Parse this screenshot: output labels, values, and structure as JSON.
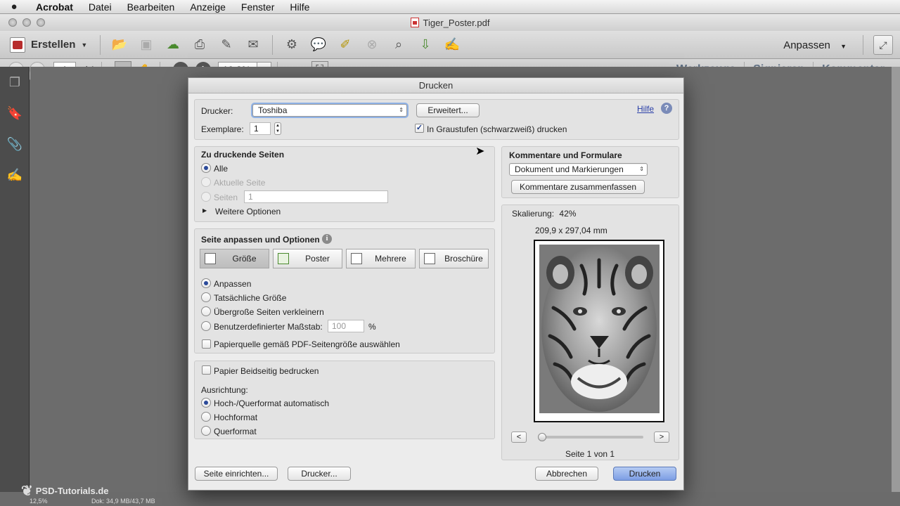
{
  "menubar": {
    "apple": "",
    "app": "Acrobat",
    "items": [
      "Datei",
      "Bearbeiten",
      "Anzeige",
      "Fenster",
      "Hilfe"
    ]
  },
  "window": {
    "title": "Tiger_Poster.pdf"
  },
  "toolbar": {
    "create_label": "Erstellen",
    "customize_label": "Anpassen",
    "page_current": "1",
    "page_total": "/ 1",
    "zoom": "19,3%",
    "tabs": [
      "Werkzeuge",
      "Signieren",
      "Kommentar"
    ]
  },
  "dialog": {
    "title": "Drucken",
    "printer_label": "Drucker:",
    "printer_value": "Toshiba",
    "advanced_button": "Erweitert...",
    "help_link": "Hilfe",
    "copies_label": "Exemplare:",
    "copies_value": "1",
    "grayscale_label": "In Graustufen (schwarzweiß) drucken",
    "grayscale_checked": true,
    "pages": {
      "heading": "Zu druckende Seiten",
      "all": "Alle",
      "current": "Aktuelle Seite",
      "range": "Seiten",
      "range_value": "1",
      "more": "Weitere Optionen"
    },
    "sizing": {
      "heading": "Seite anpassen und Optionen",
      "segments": [
        "Größe",
        "Poster",
        "Mehrere",
        "Broschüre"
      ],
      "fit": "Anpassen",
      "actual": "Tatsächliche Größe",
      "shrink": "Übergroße Seiten verkleinern",
      "custom": "Benutzerdefinierter Maßstab:",
      "custom_value": "100",
      "percent": "%",
      "paper_source": "Papierquelle gemäß PDF-Seitengröße auswählen"
    },
    "duplex": {
      "label": "Papier Beidseitig bedrucken",
      "orientation_heading": "Ausrichtung:",
      "auto": "Hoch-/Querformat automatisch",
      "portrait": "Hochformat",
      "landscape": "Querformat"
    },
    "comments": {
      "heading": "Kommentare und Formulare",
      "select_value": "Dokument und Markierungen",
      "summarize_button": "Kommentare zusammenfassen"
    },
    "preview": {
      "scaling_label": "Skalierung:",
      "scaling_value": "42%",
      "dimensions": "209,9 x 297,04 mm",
      "prev": "<",
      "next": ">",
      "page_info": "Seite 1 von 1"
    },
    "buttons": {
      "page_setup": "Seite einrichten...",
      "printer": "Drucker...",
      "cancel": "Abbrechen",
      "print": "Drucken"
    }
  },
  "status": {
    "zoom": "12,5%",
    "doc": "Dok: 34,9 MB/43,7 MB"
  },
  "watermark": "PSD-Tutorials.de",
  "colors": {
    "accent": "#7d9ee4",
    "tabs_text": "#5e6e82",
    "pdf_red": "#b72c2c"
  }
}
